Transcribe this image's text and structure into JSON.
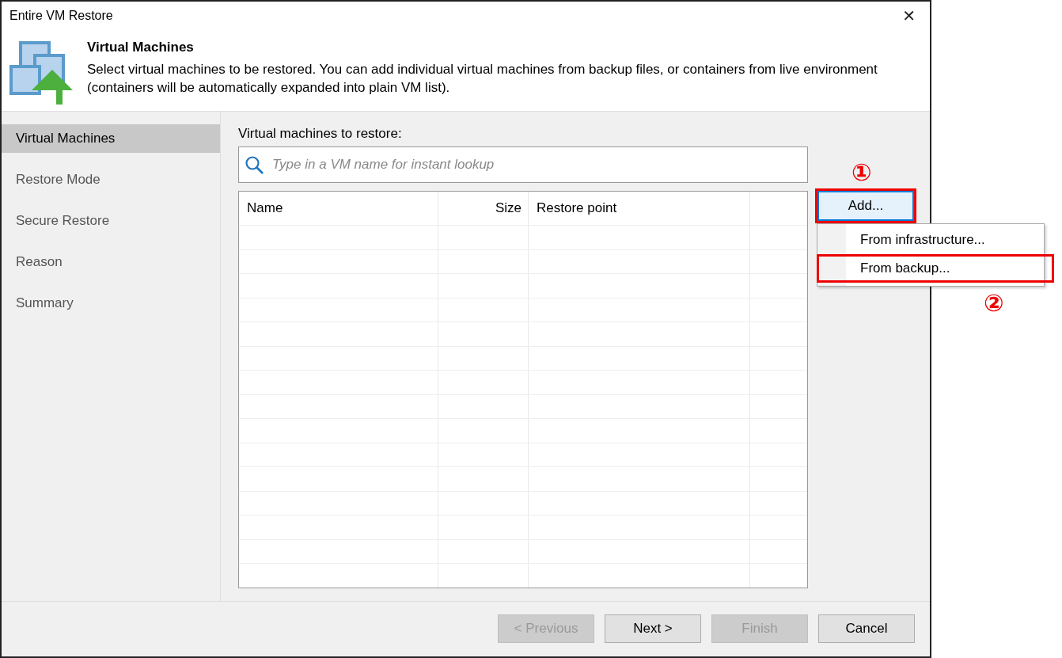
{
  "window": {
    "title": "Entire VM Restore",
    "close": "✕"
  },
  "header": {
    "title": "Virtual Machines",
    "description": "Select virtual machines to be restored. You can add individual virtual machines from backup files, or containers from live environment (containers will be automatically expanded into plain VM list)."
  },
  "sidebar": {
    "items": [
      {
        "label": "Virtual Machines",
        "selected": true
      },
      {
        "label": "Restore Mode",
        "selected": false
      },
      {
        "label": "Secure Restore",
        "selected": false
      },
      {
        "label": "Reason",
        "selected": false
      },
      {
        "label": "Summary",
        "selected": false
      }
    ]
  },
  "list_label": "Virtual machines to restore:",
  "search": {
    "placeholder": "Type in a VM name for instant lookup"
  },
  "table": {
    "columns": [
      {
        "label": "Name"
      },
      {
        "label": "Size"
      },
      {
        "label": "Restore point"
      }
    ]
  },
  "side_buttons": [
    {
      "label": "Add...",
      "disabled": false,
      "marked": true,
      "focused": true
    }
  ],
  "menu": {
    "items": [
      {
        "label": "From infrastructure...",
        "marked": false
      },
      {
        "label": "From backup...",
        "marked": true
      }
    ]
  },
  "annotations": [
    {
      "label": "①"
    },
    {
      "label": "②"
    }
  ],
  "footer_buttons": [
    {
      "label": "< Previous",
      "disabled": true
    },
    {
      "label": "Next >",
      "disabled": false
    },
    {
      "label": "Finish",
      "disabled": true
    },
    {
      "label": "Cancel",
      "disabled": false
    }
  ]
}
